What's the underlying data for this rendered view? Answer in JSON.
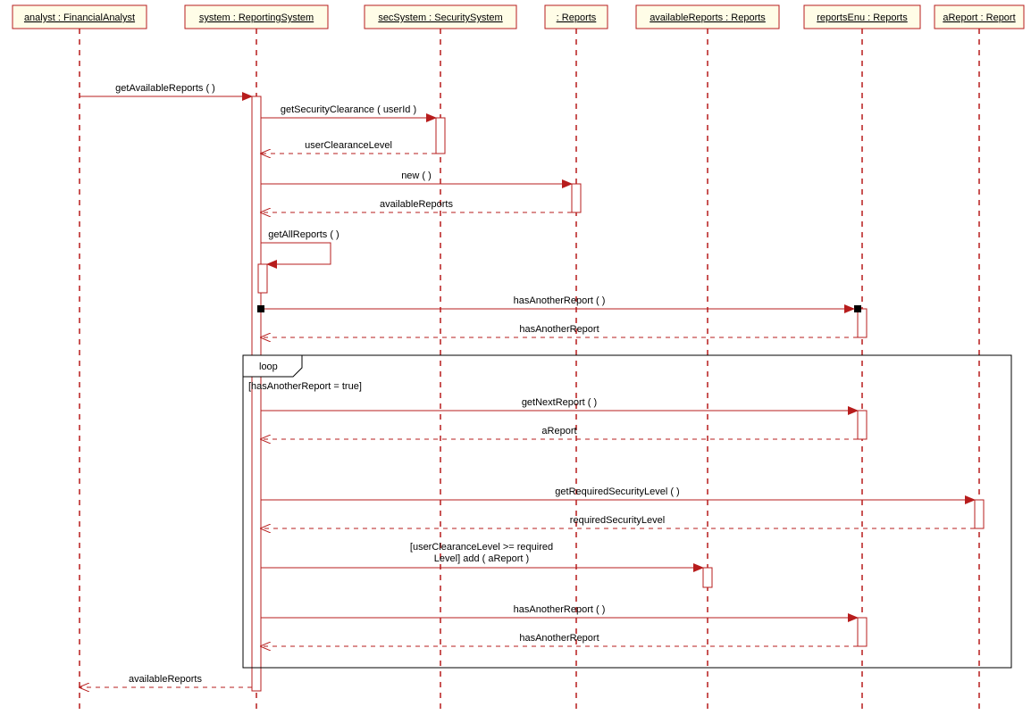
{
  "diagram_type": "UML Sequence Diagram",
  "lifelines": {
    "l1": "analyst : FinancialAnalyst",
    "l2": "system : ReportingSystem",
    "l3": "secSystem : SecuritySystem",
    "l4": " : Reports",
    "l5": "availableReports : Reports",
    "l6": "reportsEnu : Reports",
    "l7": "aReport : Report"
  },
  "messages": {
    "m1": "getAvailableReports (  )",
    "m2": "getSecurityClearance ( userId )",
    "m3": "userClearanceLevel",
    "m4": "new (  )",
    "m5": "availableReports",
    "m6": "getAllReports (  )",
    "m7": "hasAnotherReport (  )",
    "m8": "hasAnotherReport",
    "m9": "getNextReport (  )",
    "m10": "aReport",
    "m11": "getRequiredSecurityLevel (  )",
    "m12": "requiredSecurityLevel",
    "m13": "[userClearanceLevel >= required",
    "m13b": "Level] add ( aReport )",
    "m14": "hasAnotherReport (  )",
    "m15": "hasAnotherReport",
    "m16": "availableReports"
  },
  "frame": {
    "label": "loop",
    "guard": "[hasAnotherReport = true]"
  }
}
